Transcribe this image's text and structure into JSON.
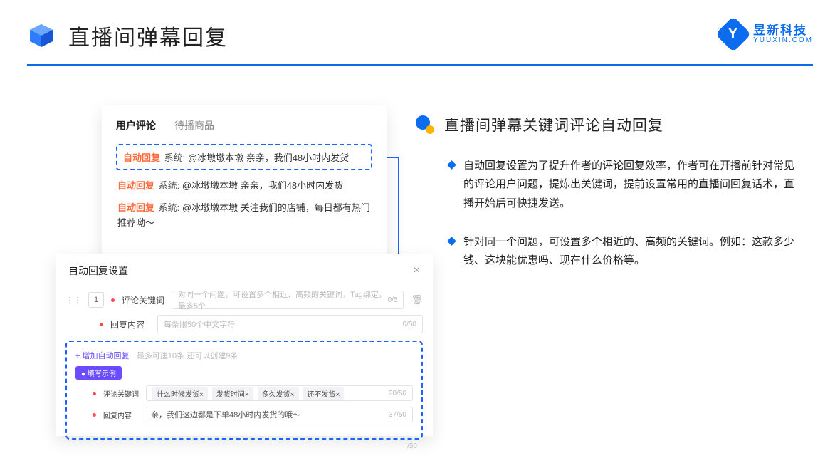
{
  "header": {
    "title": "直播间弹幕回复"
  },
  "brand": {
    "cn": "昱新科技",
    "en": "YUUXIN.COM",
    "mark": "Y"
  },
  "comments": {
    "tab_active": "用户评论",
    "tab_other": "待播商品",
    "highlight_prefix": "自动回复",
    "highlight_sys": "系统:",
    "highlight_text": "@冰墩墩本墩 亲亲，我们48小时内发货",
    "line2_prefix": "自动回复",
    "line2_sys": "系统:",
    "line2_text": "@冰墩墩本墩 亲亲，我们48小时内发货",
    "line3_prefix": "自动回复",
    "line3_sys": "系统:",
    "line3_text": "@冰墩墩本墩 关注我们的店铺，每日都有热门推荐呦～"
  },
  "settings": {
    "title": "自动回复设置",
    "order": "1",
    "kw_label": "评论关键词",
    "kw_placeholder": "对同一个问题，可设置多个相近、高频的关键词，Tag绑定，最多5个",
    "kw_count": "0/5",
    "content_label": "回复内容",
    "content_placeholder": "每条限50个中文字符",
    "content_count": "0/50",
    "add_text": "+ 增加自动回复",
    "add_sub": "最多可建10条 还可以创建9条",
    "example_pill": "● 填写示例",
    "ex_kw_label": "评论关键词",
    "ex_tags": [
      "什么时候发货×",
      "发货时间×",
      "多久发货×",
      "还不发货×"
    ],
    "ex_kw_count": "20/50",
    "ex_ct_label": "回复内容",
    "ex_ct_value": "亲，我们这边都是下单48小时内发货的哦～",
    "ex_ct_count": "37/50",
    "stray_count": "/50"
  },
  "right": {
    "title": "直播间弹幕关键词评论自动回复",
    "b1": "自动回复设置为了提升作者的评论回复效率，作者可在开播前针对常见的评论用户问题，提炼出关键词，提前设置常用的直播间回复话术，直播开始后可快捷发送。",
    "b2": "针对同一个问题，可设置多个相近的、高频的关键词。例如：这款多少钱、这块能优惠吗、现在什么价格等。"
  }
}
